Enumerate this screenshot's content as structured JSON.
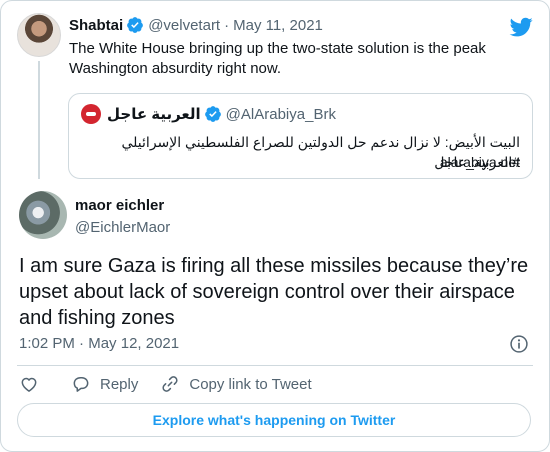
{
  "colors": {
    "accent": "#1d9bf0",
    "text": "#0f1419",
    "muted": "#536471",
    "border": "#cfd9de"
  },
  "parent_tweet": {
    "author_name": "Shabtai",
    "author_handle": "@velvetart",
    "separator": "·",
    "date": "May 11, 2021",
    "text": "The White House bringing up the two-state solution is the peak Washington absurdity right now.",
    "quoted": {
      "author_name": "العربية عاجل",
      "author_handle": "@AlArabiya_Brk",
      "text": "البيت الأبيض: لا نزال ندعم حل الدولتين للصراع الفلسطيني الإسرائيلي #العربية_عاجل",
      "link": "alarabiya.net"
    }
  },
  "main_tweet": {
    "author_name": "maor eichler",
    "author_handle": "@EichlerMaor",
    "text": "I am sure Gaza is firing all these missiles because they’re upset about lack of sovereign control over their airspace and fishing zones",
    "time": "1:02 PM",
    "separator": "·",
    "date": "May 12, 2021"
  },
  "actions": {
    "reply": "Reply",
    "copy_link": "Copy link to Tweet"
  },
  "explore_button": "Explore what's happening on Twitter",
  "icons": {
    "bird": "twitter-bird-icon",
    "verified": "verified-badge-icon",
    "info": "info-icon",
    "like": "heart-icon",
    "reply": "reply-icon",
    "link": "link-icon"
  }
}
